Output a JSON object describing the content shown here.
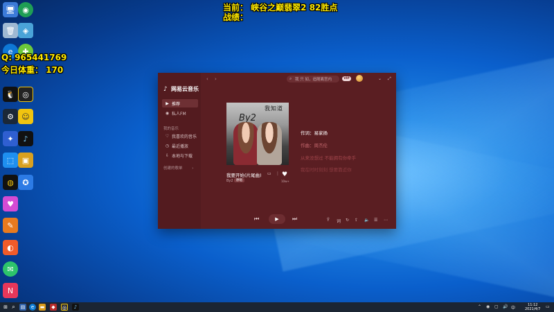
{
  "overlay": {
    "current": "当前： 峡谷之巅翡翠2  82胜点",
    "record": "战绩：",
    "qq": "Q: 965441769",
    "weight": "今日体重： 170"
  },
  "player": {
    "logo_text": "网易云音乐",
    "search_placeholder": "我 只 如，追随离宫内",
    "vip": "VIP",
    "nav": {
      "recommend": "推荐",
      "fm": "私人FM",
      "my_music_heading": "我的音乐",
      "liked": "我喜欢的音乐",
      "recent": "最近播放",
      "download": "本地与下载",
      "created_playlists": "创建的歌单"
    },
    "album": {
      "title": "我知道",
      "artist_logo": "By2"
    },
    "song": {
      "title": "我要开始(片尾曲)",
      "artist": "By2",
      "tag": "原唱",
      "like_count": "10w+"
    },
    "lyrics": [
      "作词：易家扬",
      "作曲：周杰伦",
      "从来没想过 不能拥有你牵手",
      "我在时时刻刻 想要靠近你"
    ],
    "controls": {
      "prev": "⏮",
      "play": "▶",
      "next": "⏭"
    }
  },
  "taskbar": {
    "time": "11:12",
    "date": "2021/4/7"
  }
}
